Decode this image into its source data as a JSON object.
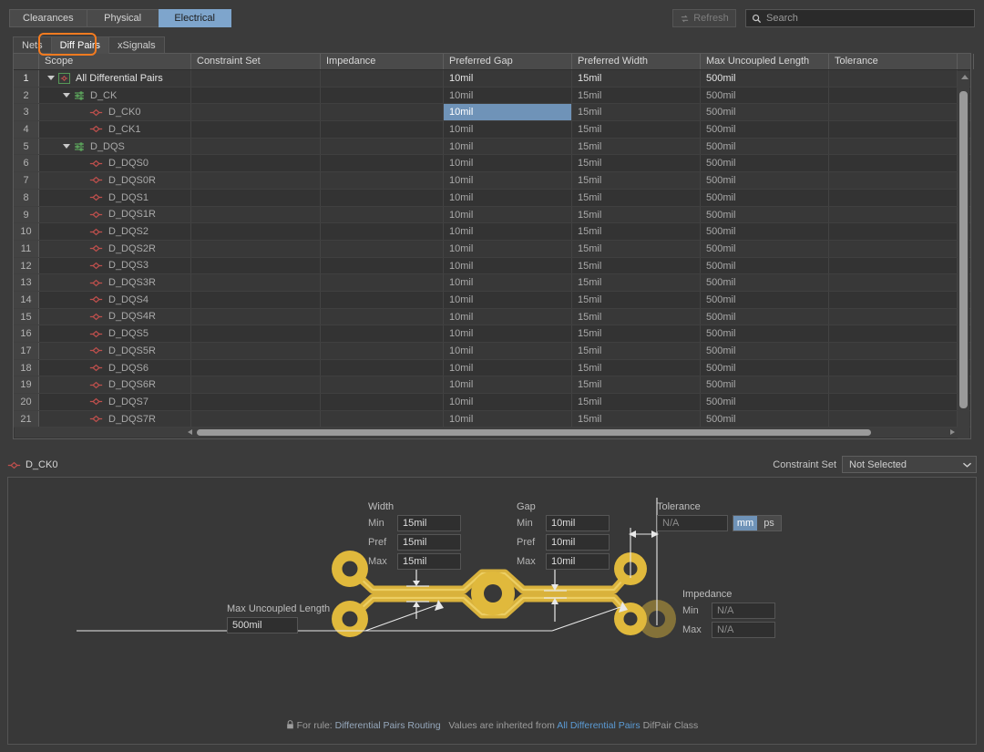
{
  "main_tabs": [
    {
      "label": "Clearances",
      "active": false
    },
    {
      "label": "Physical",
      "active": false
    },
    {
      "label": "Electrical",
      "active": true
    }
  ],
  "toolbar": {
    "refresh_label": "Refresh",
    "refresh_icon": "refresh-icon",
    "search_placeholder": "Search",
    "search_icon": "search-icon"
  },
  "sub_tabs": [
    {
      "label": "Nets",
      "active": false
    },
    {
      "label": "Diff Pairs",
      "active": true
    },
    {
      "label": "xSignals",
      "active": false
    }
  ],
  "table": {
    "columns": [
      {
        "label": "",
        "width": 28
      },
      {
        "label": "Scope",
        "width": 167
      },
      {
        "label": "Constraint Set",
        "width": 142
      },
      {
        "label": "Impedance",
        "width": 135
      },
      {
        "label": "Preferred Gap",
        "width": 141
      },
      {
        "label": "Preferred Width",
        "width": 141
      },
      {
        "label": "Max Uncoupled Length",
        "width": 141
      },
      {
        "label": "Tolerance",
        "width": 141
      },
      {
        "label": "",
        "width": 18
      }
    ],
    "rows": [
      {
        "n": "1",
        "scope": "All Differential Pairs",
        "indent": 0,
        "icon": "diffpair-class-root-icon",
        "twisty": true,
        "constraint_set": "",
        "impedance": "",
        "gap": "10mil",
        "width": "15mil",
        "max_uncoupled": "500mil",
        "tolerance": ""
      },
      {
        "n": "2",
        "scope": "D_CK",
        "indent": 1,
        "icon": "diffpair-class-icon",
        "twisty": true,
        "constraint_set": "",
        "impedance": "",
        "gap": "10mil",
        "width": "15mil",
        "max_uncoupled": "500mil",
        "tolerance": ""
      },
      {
        "n": "3",
        "scope": "D_CK0",
        "indent": 2,
        "icon": "diffpair-icon",
        "twisty": false,
        "constraint_set": "",
        "impedance": "",
        "gap": "10mil",
        "width": "15mil",
        "max_uncoupled": "500mil",
        "tolerance": "",
        "selected_cell": "gap"
      },
      {
        "n": "4",
        "scope": "D_CK1",
        "indent": 2,
        "icon": "diffpair-icon",
        "twisty": false,
        "constraint_set": "",
        "impedance": "",
        "gap": "10mil",
        "width": "15mil",
        "max_uncoupled": "500mil",
        "tolerance": ""
      },
      {
        "n": "5",
        "scope": "D_DQS",
        "indent": 1,
        "icon": "diffpair-class-icon",
        "twisty": true,
        "constraint_set": "",
        "impedance": "",
        "gap": "10mil",
        "width": "15mil",
        "max_uncoupled": "500mil",
        "tolerance": ""
      },
      {
        "n": "6",
        "scope": "D_DQS0",
        "indent": 2,
        "icon": "diffpair-icon",
        "twisty": false,
        "constraint_set": "",
        "impedance": "",
        "gap": "10mil",
        "width": "15mil",
        "max_uncoupled": "500mil",
        "tolerance": ""
      },
      {
        "n": "7",
        "scope": "D_DQS0R",
        "indent": 2,
        "icon": "diffpair-icon",
        "twisty": false,
        "constraint_set": "",
        "impedance": "",
        "gap": "10mil",
        "width": "15mil",
        "max_uncoupled": "500mil",
        "tolerance": ""
      },
      {
        "n": "8",
        "scope": "D_DQS1",
        "indent": 2,
        "icon": "diffpair-icon",
        "twisty": false,
        "constraint_set": "",
        "impedance": "",
        "gap": "10mil",
        "width": "15mil",
        "max_uncoupled": "500mil",
        "tolerance": ""
      },
      {
        "n": "9",
        "scope": "D_DQS1R",
        "indent": 2,
        "icon": "diffpair-icon",
        "twisty": false,
        "constraint_set": "",
        "impedance": "",
        "gap": "10mil",
        "width": "15mil",
        "max_uncoupled": "500mil",
        "tolerance": ""
      },
      {
        "n": "10",
        "scope": "D_DQS2",
        "indent": 2,
        "icon": "diffpair-icon",
        "twisty": false,
        "constraint_set": "",
        "impedance": "",
        "gap": "10mil",
        "width": "15mil",
        "max_uncoupled": "500mil",
        "tolerance": ""
      },
      {
        "n": "11",
        "scope": "D_DQS2R",
        "indent": 2,
        "icon": "diffpair-icon",
        "twisty": false,
        "constraint_set": "",
        "impedance": "",
        "gap": "10mil",
        "width": "15mil",
        "max_uncoupled": "500mil",
        "tolerance": ""
      },
      {
        "n": "12",
        "scope": "D_DQS3",
        "indent": 2,
        "icon": "diffpair-icon",
        "twisty": false,
        "constraint_set": "",
        "impedance": "",
        "gap": "10mil",
        "width": "15mil",
        "max_uncoupled": "500mil",
        "tolerance": ""
      },
      {
        "n": "13",
        "scope": "D_DQS3R",
        "indent": 2,
        "icon": "diffpair-icon",
        "twisty": false,
        "constraint_set": "",
        "impedance": "",
        "gap": "10mil",
        "width": "15mil",
        "max_uncoupled": "500mil",
        "tolerance": ""
      },
      {
        "n": "14",
        "scope": "D_DQS4",
        "indent": 2,
        "icon": "diffpair-icon",
        "twisty": false,
        "constraint_set": "",
        "impedance": "",
        "gap": "10mil",
        "width": "15mil",
        "max_uncoupled": "500mil",
        "tolerance": ""
      },
      {
        "n": "15",
        "scope": "D_DQS4R",
        "indent": 2,
        "icon": "diffpair-icon",
        "twisty": false,
        "constraint_set": "",
        "impedance": "",
        "gap": "10mil",
        "width": "15mil",
        "max_uncoupled": "500mil",
        "tolerance": ""
      },
      {
        "n": "16",
        "scope": "D_DQS5",
        "indent": 2,
        "icon": "diffpair-icon",
        "twisty": false,
        "constraint_set": "",
        "impedance": "",
        "gap": "10mil",
        "width": "15mil",
        "max_uncoupled": "500mil",
        "tolerance": ""
      },
      {
        "n": "17",
        "scope": "D_DQS5R",
        "indent": 2,
        "icon": "diffpair-icon",
        "twisty": false,
        "constraint_set": "",
        "impedance": "",
        "gap": "10mil",
        "width": "15mil",
        "max_uncoupled": "500mil",
        "tolerance": ""
      },
      {
        "n": "18",
        "scope": "D_DQS6",
        "indent": 2,
        "icon": "diffpair-icon",
        "twisty": false,
        "constraint_set": "",
        "impedance": "",
        "gap": "10mil",
        "width": "15mil",
        "max_uncoupled": "500mil",
        "tolerance": ""
      },
      {
        "n": "19",
        "scope": "D_DQS6R",
        "indent": 2,
        "icon": "diffpair-icon",
        "twisty": false,
        "constraint_set": "",
        "impedance": "",
        "gap": "10mil",
        "width": "15mil",
        "max_uncoupled": "500mil",
        "tolerance": ""
      },
      {
        "n": "20",
        "scope": "D_DQS7",
        "indent": 2,
        "icon": "diffpair-icon",
        "twisty": false,
        "constraint_set": "",
        "impedance": "",
        "gap": "10mil",
        "width": "15mil",
        "max_uncoupled": "500mil",
        "tolerance": ""
      },
      {
        "n": "21",
        "scope": "D_DQS7R",
        "indent": 2,
        "icon": "diffpair-icon",
        "twisty": false,
        "constraint_set": "",
        "impedance": "",
        "gap": "10mil",
        "width": "15mil",
        "max_uncoupled": "500mil",
        "tolerance": ""
      }
    ]
  },
  "selected_pair": {
    "name": "D_CK0",
    "icon": "diffpair-icon",
    "constraint_set_label": "Constraint Set",
    "constraint_set_value": "Not Selected"
  },
  "editor": {
    "width": {
      "title": "Width",
      "min_label": "Min",
      "min_value": "15mil",
      "pref_label": "Pref",
      "pref_value": "15mil",
      "max_label": "Max",
      "max_value": "15mil"
    },
    "gap": {
      "title": "Gap",
      "min_label": "Min",
      "min_value": "10mil",
      "pref_label": "Pref",
      "pref_value": "10mil",
      "max_label": "Max",
      "max_value": "10mil"
    },
    "tolerance": {
      "title": "Tolerance",
      "value": "N/A",
      "unit_mm": "mm",
      "unit_ps": "ps",
      "unit_selected": "mm"
    },
    "impedance": {
      "title": "Impedance",
      "min_label": "Min",
      "min_value": "N/A",
      "max_label": "Max",
      "max_value": "N/A"
    },
    "max_uncoupled": {
      "title": "Max Uncoupled Length",
      "value": "500mil"
    }
  },
  "footer": {
    "lock_icon": "lock-icon",
    "prefix": "For rule:",
    "rule_name": "Differential Pairs Routing",
    "middle": "Values are inherited from",
    "link": "All Differential Pairs",
    "suffix": "DifPair Class"
  },
  "colors": {
    "accent_blue": "#6f93b8",
    "highlight_orange": "#f47b20",
    "trace_gold": "#e0b93c",
    "link_blue": "#5b9bd5",
    "diffpair_red": "#c0504d",
    "class_green": "#5aa05a"
  }
}
